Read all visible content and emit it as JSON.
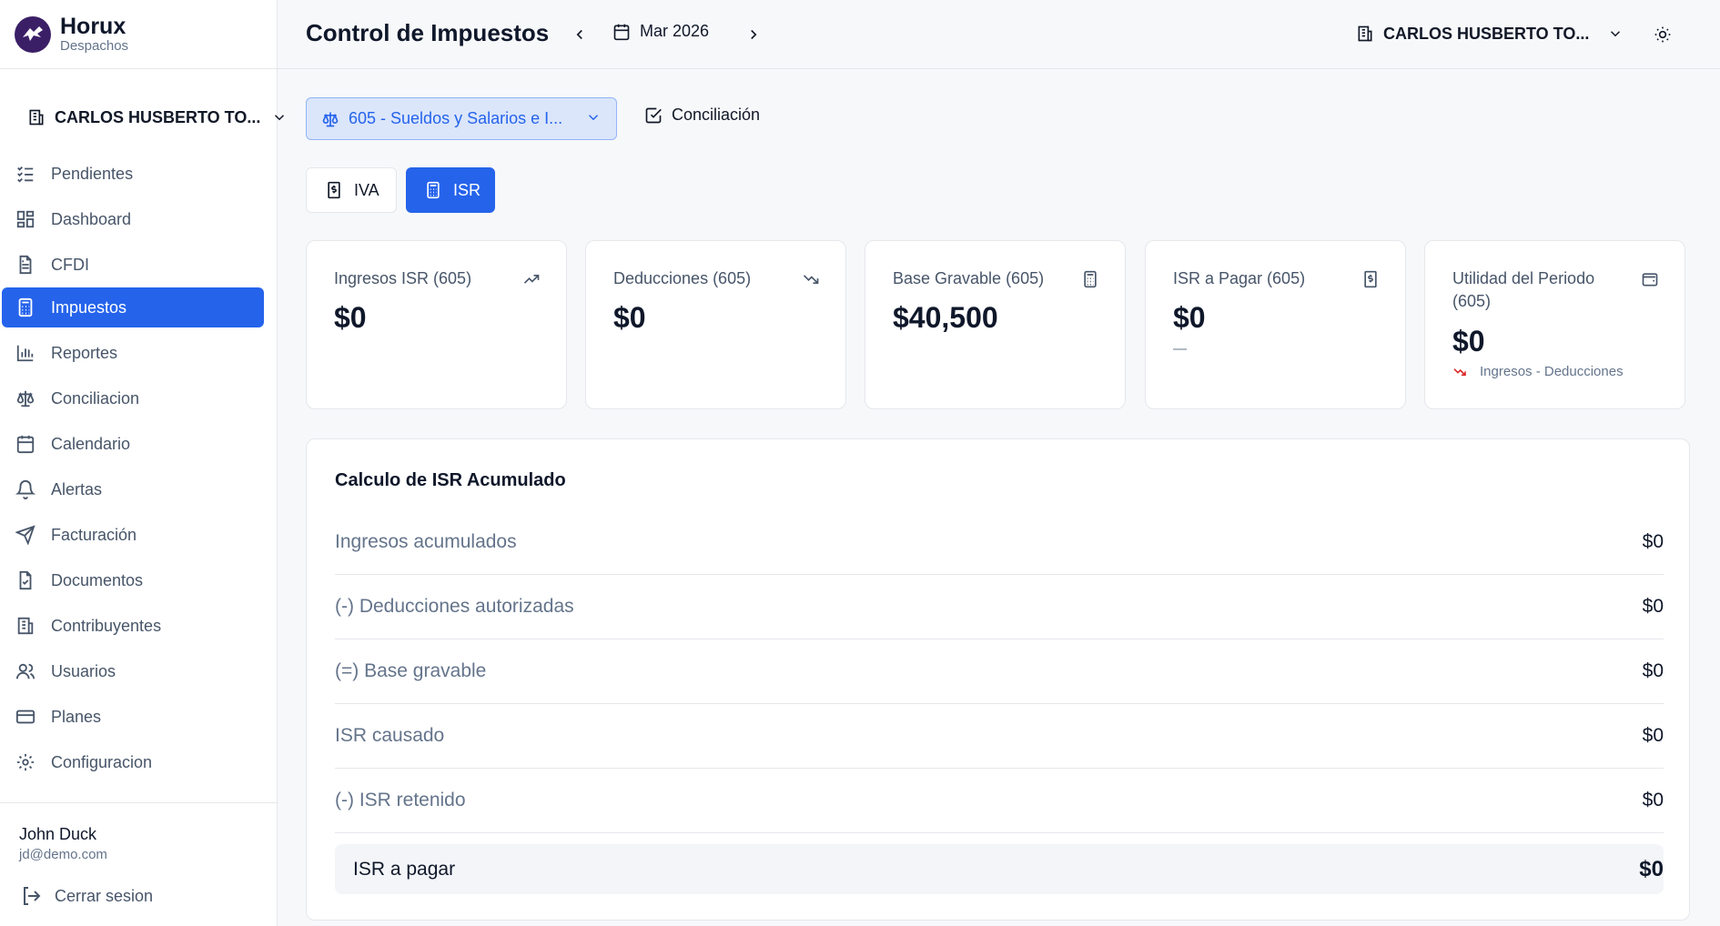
{
  "brand": {
    "name": "Horux",
    "subtitle": "Despachos"
  },
  "sidebar": {
    "company_selector": "CARLOS HUSBERTO TO...",
    "items": [
      {
        "label": "Pendientes",
        "icon": "list-check-icon"
      },
      {
        "label": "Dashboard",
        "icon": "dashboard-icon"
      },
      {
        "label": "CFDI",
        "icon": "file-text-icon"
      },
      {
        "label": "Impuestos",
        "icon": "calculator-icon",
        "active": true
      },
      {
        "label": "Reportes",
        "icon": "bar-chart-icon"
      },
      {
        "label": "Conciliacion",
        "icon": "scale-icon"
      },
      {
        "label": "Calendario",
        "icon": "calendar-icon"
      },
      {
        "label": "Alertas",
        "icon": "bell-icon"
      },
      {
        "label": "Facturación",
        "icon": "send-icon"
      },
      {
        "label": "Documentos",
        "icon": "file-check-icon"
      },
      {
        "label": "Contribuyentes",
        "icon": "building-icon"
      },
      {
        "label": "Usuarios",
        "icon": "users-icon"
      },
      {
        "label": "Planes",
        "icon": "credit-card-icon"
      },
      {
        "label": "Configuracion",
        "icon": "gear-icon"
      }
    ],
    "user": {
      "name": "John Duck",
      "email": "jd@demo.com"
    },
    "logout_label": "Cerrar sesion"
  },
  "header": {
    "title": "Control de Impuestos",
    "period": "Mar 2026",
    "company": "CARLOS HUSBERTO TO..."
  },
  "toolbar": {
    "regimen": "605 - Sueldos y Salarios e I...",
    "conciliacion_label": "Conciliación"
  },
  "tabs": [
    {
      "label": "IVA",
      "active": false
    },
    {
      "label": "ISR",
      "active": true
    }
  ],
  "cards": [
    {
      "title": "Ingresos ISR (605)",
      "value": "$0",
      "icon": "trending-up-icon"
    },
    {
      "title": "Deducciones (605)",
      "value": "$0",
      "icon": "trending-down-icon"
    },
    {
      "title": "Base Gravable (605)",
      "value": "$40,500",
      "icon": "calculator-icon"
    },
    {
      "title": "ISR a Pagar (605)",
      "value": "$0",
      "icon": "receipt-icon",
      "note": "—"
    },
    {
      "title": "Utilidad del Periodo (605)",
      "value": "$0",
      "icon": "wallet-icon",
      "trend_label": "Ingresos - Deducciones"
    }
  ],
  "calc": {
    "title": "Calculo de ISR Acumulado",
    "rows": [
      {
        "label": "Ingresos acumulados",
        "value": "$0"
      },
      {
        "label": "(-) Deducciones autorizadas",
        "value": "$0"
      },
      {
        "label": "(=) Base gravable",
        "value": "$0"
      },
      {
        "label": "ISR causado",
        "value": "$0"
      },
      {
        "label": "(-) ISR retenido",
        "value": "$0"
      }
    ],
    "total": {
      "label": "ISR a pagar",
      "value": "$0"
    }
  },
  "colors": {
    "accent": "#2563eb",
    "brand": "#3b1f66",
    "trend_down": "#dc2626"
  }
}
